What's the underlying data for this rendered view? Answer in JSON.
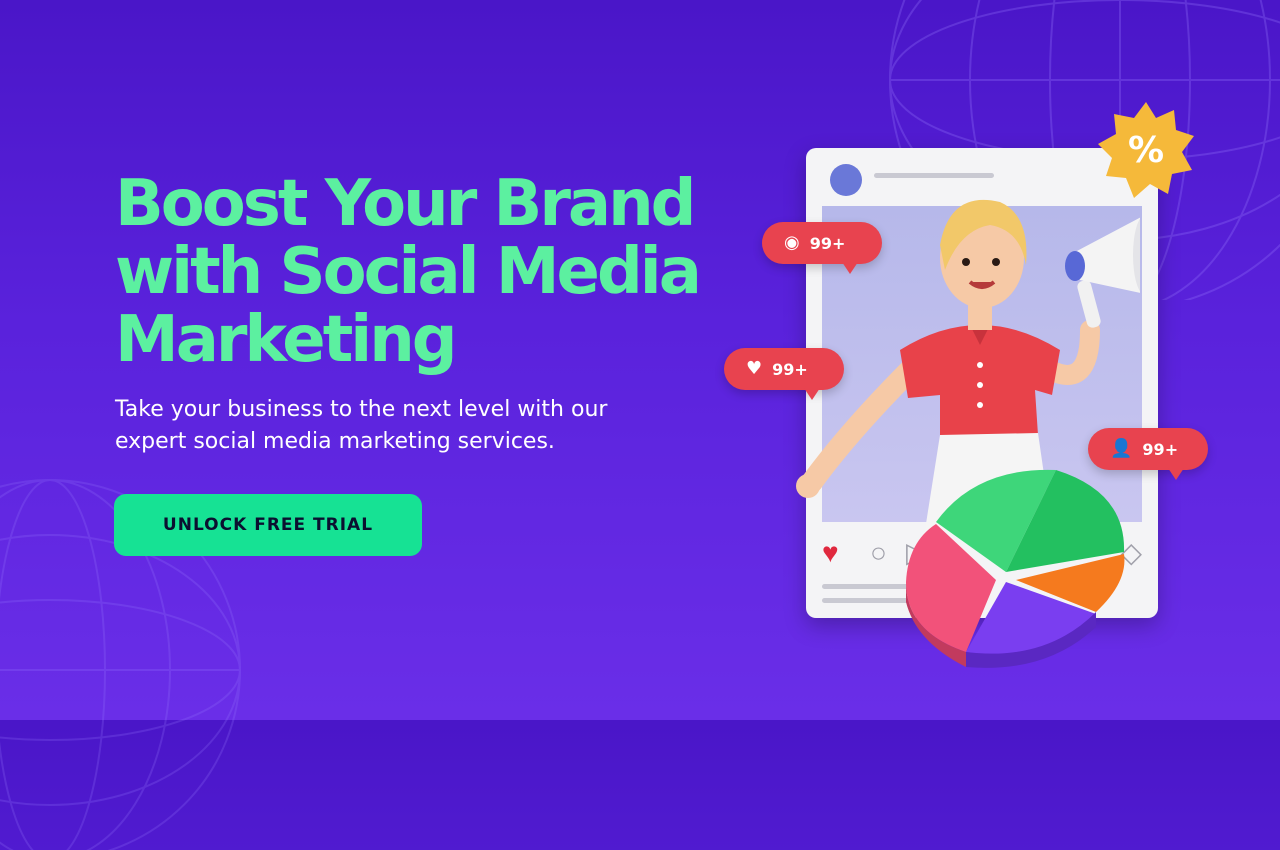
{
  "hero": {
    "headline_line1": "Boost Your Brand",
    "headline_line2": "with Social Media",
    "headline_line3": "Marketing",
    "subtext": "Take your business to the next level with our expert social media marketing services.",
    "cta_label": "UNLOCK FREE TRIAL"
  },
  "badges": {
    "views": "99+",
    "likes": "99+",
    "followers": "99+"
  },
  "discount_badge": "%",
  "colors": {
    "background": "#5a22dc",
    "headline": "#5cf0a0",
    "cta": "#16e294",
    "bubble": "#e8434f"
  },
  "icons": [
    "eye-icon",
    "heart-icon",
    "user-icon",
    "comment-icon",
    "share-icon",
    "bookmark-icon",
    "megaphone-icon"
  ]
}
